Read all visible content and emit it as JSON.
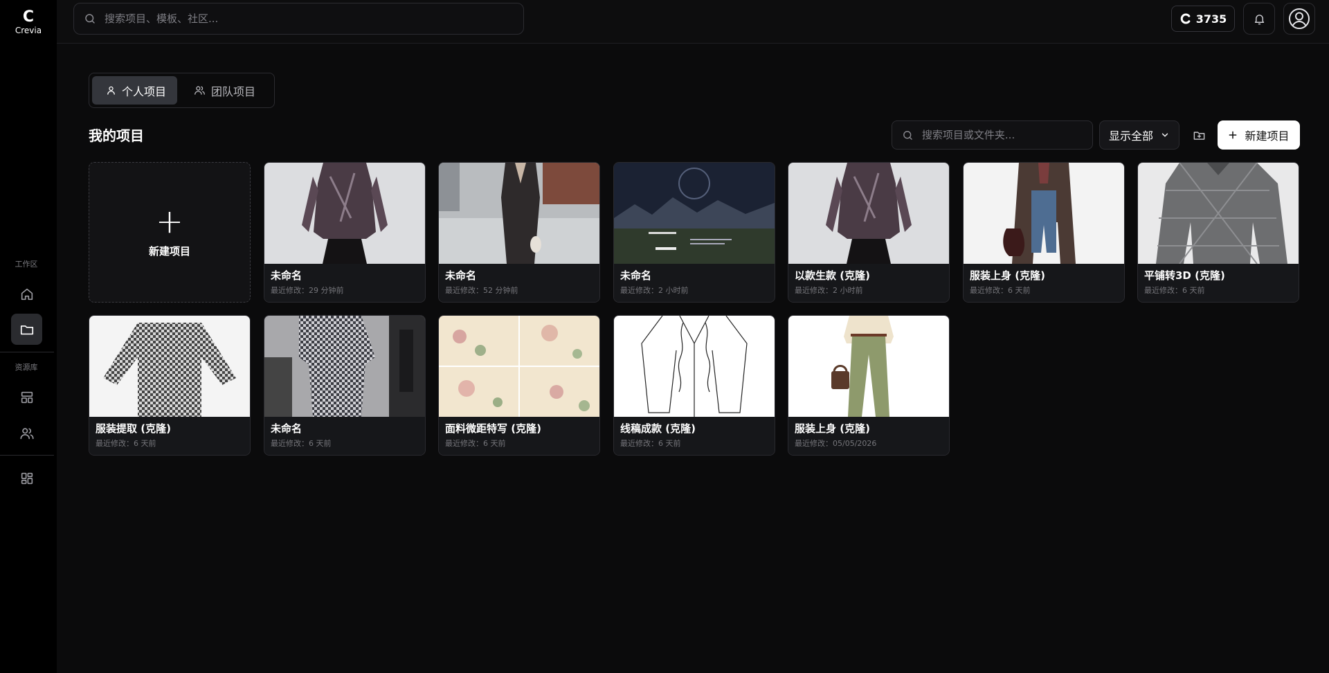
{
  "app": {
    "logo_text": "Crevia",
    "logo_mark": "C"
  },
  "sidebar": {
    "workspace_label": "工作区",
    "library_label": "资源库",
    "items": [
      {
        "icon": "home-icon"
      },
      {
        "icon": "folder-icon",
        "active": true
      },
      {
        "icon": "layout-icon"
      },
      {
        "icon": "users-icon"
      },
      {
        "icon": "apps-grid-icon"
      }
    ]
  },
  "header": {
    "search_placeholder": "搜索项目、模板、社区...",
    "credits": "3735"
  },
  "tabs": [
    {
      "label": "个人项目",
      "active": true
    },
    {
      "label": "团队项目",
      "active": false
    }
  ],
  "section": {
    "title": "我的项目",
    "search_placeholder": "搜索项目或文件夹...",
    "filter_label": "显示全部",
    "new_button_label": "新建项目"
  },
  "new_card_label": "新建项目",
  "projects": [
    {
      "title": "未命名",
      "time": "最近修改：29 分钟前"
    },
    {
      "title": "未命名",
      "time": "最近修改：52 分钟前"
    },
    {
      "title": "未命名",
      "time": "最近修改：2 小时前"
    },
    {
      "title": "以款生款 (克隆)",
      "time": "最近修改：2 小时前"
    },
    {
      "title": "服装上身 (克隆)",
      "time": "最近修改：6 天前"
    },
    {
      "title": "平铺转3D (克隆)",
      "time": "最近修改：6 天前"
    },
    {
      "title": "服装提取 (克隆)",
      "time": "最近修改：6 天前"
    },
    {
      "title": "未命名",
      "time": "最近修改：6 天前"
    },
    {
      "title": "面料微距特写 (克隆)",
      "time": "最近修改：6 天前"
    },
    {
      "title": "线稿成款 (克隆)",
      "time": "最近修改：6 天前"
    },
    {
      "title": "服装上身 (克隆)",
      "time": "最近修改：05/05/2026"
    }
  ]
}
